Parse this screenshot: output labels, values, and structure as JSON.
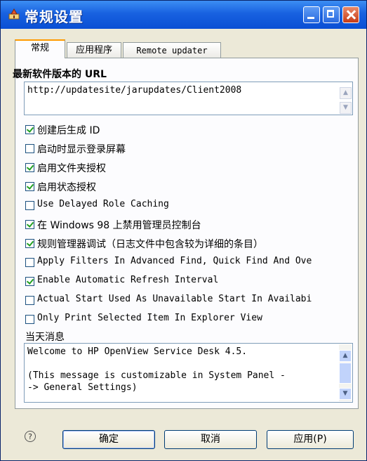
{
  "window": {
    "title": "常规设置"
  },
  "tabs": [
    {
      "label": "常规"
    },
    {
      "label": "应用程序"
    },
    {
      "label": "Remote updater"
    }
  ],
  "url": {
    "label": "最新软件版本的 URL",
    "value": "http://updatesite/jarupdates/Client2008"
  },
  "options": [
    {
      "label": "创建后生成 ID",
      "checked": true
    },
    {
      "label": "启动时显示登录屏幕",
      "checked": false
    },
    {
      "label": "启用文件夹授权",
      "checked": true
    },
    {
      "label": "启用状态授权",
      "checked": true
    },
    {
      "label": "Use Delayed Role Caching",
      "checked": false
    },
    {
      "label": "在 Windows 98 上禁用管理员控制台",
      "checked": true
    },
    {
      "label": "规则管理器调试（日志文件中包含较为详细的条目）",
      "checked": true
    },
    {
      "label": "Apply Filters In Advanced Find, Quick Find And Ove",
      "checked": false
    },
    {
      "label": "Enable Automatic Refresh Interval",
      "checked": true
    },
    {
      "label": "Actual Start Used As Unavailable Start In Availabi",
      "checked": false
    },
    {
      "label": "Only Print Selected Item In Explorer View",
      "checked": false
    }
  ],
  "message": {
    "label": "当天消息",
    "value": "Welcome to HP OpenView Service Desk 4.5.\n\n(This message is customizable in System Panel -\n-> General Settings)"
  },
  "footer": {
    "help": "?",
    "ok": "确定",
    "cancel": "取消",
    "apply": "应用(P)"
  }
}
